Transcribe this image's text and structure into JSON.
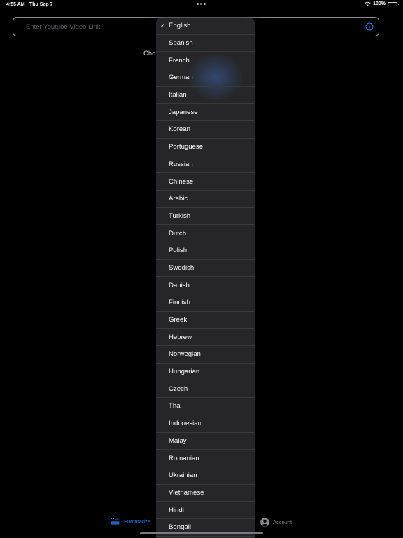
{
  "status_bar": {
    "time": "4:55 AM",
    "date": "Thu Sep 7",
    "battery": "100%"
  },
  "search": {
    "placeholder": "Enter Youtube Video Link",
    "value": ""
  },
  "choose_label": "Cho",
  "language_menu": {
    "selected": "English",
    "items": [
      "English",
      "Spanish",
      "French",
      "German",
      "Italian",
      "Japanese",
      "Korean",
      "Portuguese",
      "Russian",
      "Chinese",
      "Arabic",
      "Turkish",
      "Dutch",
      "Polish",
      "Swedish",
      "Danish",
      "Finnish",
      "Greek",
      "Hebrew",
      "Norwegian",
      "Hungarian",
      "Czech",
      "Thai",
      "Indonesian",
      "Malay",
      "Romanian",
      "Ukrainian",
      "Vietnamese",
      "Hindi",
      "Bengali"
    ]
  },
  "tab_bar": {
    "summarize_label": "Summarize",
    "account_label": "Account"
  },
  "colors": {
    "accent": "#2f7cf6",
    "background": "#000000",
    "menu_background": "#262628"
  }
}
